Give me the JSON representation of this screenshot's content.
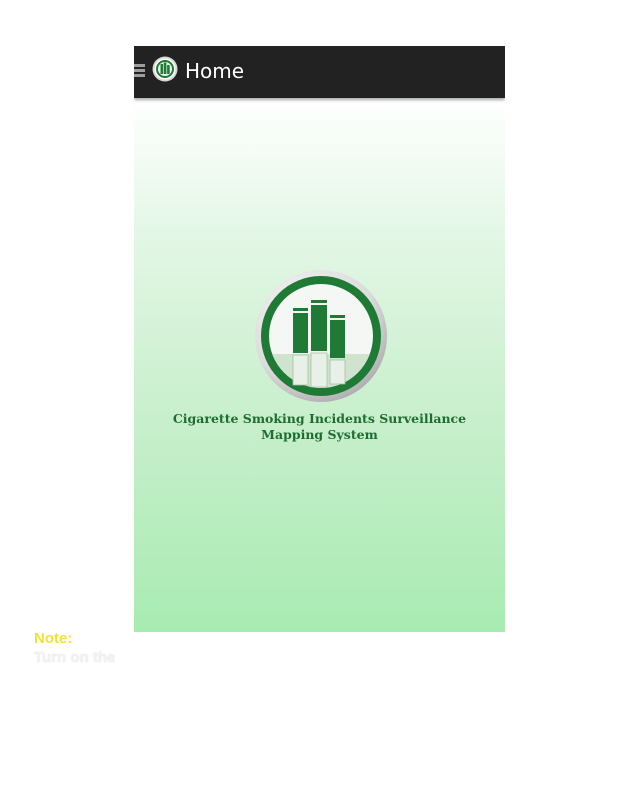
{
  "action_bar": {
    "title": "Home",
    "menu_icon": "hamburger-menu-icon",
    "app_icon": "app-logo-icon",
    "background": "#222222"
  },
  "splash": {
    "app_name_line1": "Cigarette Smoking Incidents Surveillance",
    "app_name_line2": "Mapping System",
    "logo": "cigarette-bars-logo",
    "text_color": "#1e6d30",
    "brand_green": "#1f7a35"
  },
  "note": {
    "label": "Note:",
    "text": "Turn on the"
  }
}
